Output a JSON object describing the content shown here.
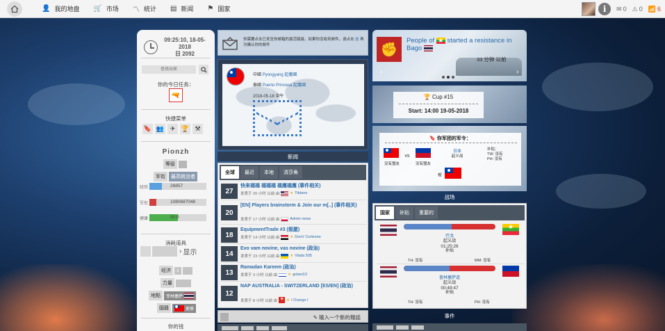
{
  "nav": {
    "items": [
      {
        "icon": "user-icon",
        "label": "我的地盘"
      },
      {
        "icon": "cart-icon",
        "label": "市场"
      },
      {
        "icon": "chart-icon",
        "label": "统计"
      },
      {
        "icon": "news-icon",
        "label": "新闻"
      },
      {
        "icon": "flag-icon",
        "label": "国家"
      }
    ],
    "messages": "0",
    "alerts": "0",
    "notifications": "6"
  },
  "left": {
    "clock_line1": "09:25:10, 18-05-",
    "clock_line2": "2018",
    "clock_line3": "日 2092",
    "search_placeholder": "查找玩家",
    "missions_label": "你的今日任务：",
    "quick_menu_label": "快捷菜单",
    "player_name": "Pionzh",
    "level_label": "等级",
    "rank_label": "军衔",
    "rank_value": "最高统治者",
    "stats": [
      {
        "label": "经验",
        "value": "26857",
        "fill_pct": 22,
        "color": "#5a9fe0"
      },
      {
        "label": "军衔",
        "value": "1080687048",
        "fill_pct": 12,
        "color": "#d04040"
      },
      {
        "label": "健康",
        "value": "50.0",
        "fill_pct": 50,
        "color": "#4cae4c"
      }
    ],
    "consumables_label": "消耗道具",
    "show_label": "显示",
    "economy_label": "经济",
    "economy_value": "1",
    "strength_label": "力量",
    "location_label": "地點",
    "location_value": "菲林塞萨",
    "citizenship_label": "國籍",
    "citizenship_value": "更换",
    "money_label": "你的钱"
  },
  "notice": {
    "text_part1": "你需要点击已发至你邮箱的激活链接，如果你没收到邮件，请点击",
    "link": "这",
    "text_part2": "再次确认你的邮件"
  },
  "news": {
    "line1_prefix": "中國",
    "line1_city": "Pyongyang",
    "line1_link": "起義國",
    "line2_prefix": "泰國",
    "line2_city": "Puerto Princesa",
    "line2_link": "起義國",
    "date": "2018-05-18 中午",
    "caption": "新闻"
  },
  "feed": {
    "tabs": [
      "全球",
      "最近",
      "本地",
      "清莎角"
    ],
    "items": [
      {
        "count": "27",
        "title": "快来福福 福福福 福鹰福鹰 (事件相关)",
        "meta": "发表于 20 小时 以前 由",
        "author": "Tibbers",
        "flag": "f-us"
      },
      {
        "count": "20",
        "title": "[EN] Players brainstorm & Join our m[..] (事件相关)",
        "meta": "发表于 17 小时 以前 由",
        "author": "Admin news",
        "flag": "f-pl"
      },
      {
        "count": "18",
        "title": "EquipmentTrade #3 (假屋)",
        "meta": "发表于 14 小时 以前 由",
        "author": "DonV Corleone",
        "flag": "f-eg"
      },
      {
        "count": "14",
        "title": "Evo vam novine, vas novine (政治)",
        "meta": "发表于 23 小时 以前 由",
        "author": "Vlada 505",
        "flag": "f-ua"
      },
      {
        "count": "13",
        "title": "Ramadan Kareem (政治)",
        "meta": "发表于 3 小时 以前 由",
        "author": "golani13",
        "flag": "f-il"
      },
      {
        "count": "12",
        "title": "NAP AUSTRALIA - SWITZERLAND [ES/EN] (政治)",
        "meta": "发表于 8 小时 以前 由",
        "author": "I Orange I",
        "flag": "f-ch"
      }
    ],
    "write_label": "输入一个新的報話"
  },
  "resistance": {
    "title_pre": "People of",
    "title_post": "started a resistance in Bago",
    "time": "33 分钟 以前"
  },
  "cup": {
    "title": "Cup #15",
    "start": "Start: 14:00 19-05-2018"
  },
  "army": {
    "heading": "你军团的军令：",
    "left_caption": "没有盟友",
    "vs": "vs",
    "mid_caption": "没有盟友",
    "link_name": "日本",
    "link_sub": "起义战",
    "right_line1": "补贴：",
    "right_line2": "TW: 没有",
    "right_line3": "PH: 没有",
    "help_label": "帮"
  },
  "battles_section": {
    "label": "战场",
    "tabs": [
      "国家",
      "补贴",
      "重要的"
    ],
    "items": [
      {
        "name": "巴戈",
        "type": "起义战",
        "timer": "01:25:26",
        "sub": "补贴",
        "left_flag": "f-th",
        "right_flag": "f-mm",
        "left_foot": "TH: 没有",
        "right_foot": "MM: 没有",
        "left_pct": 52
      },
      {
        "name": "普林塞萨道",
        "type": "起义战",
        "timer": "00:49:47",
        "sub": "补贴",
        "left_flag": "f-th",
        "right_flag": "f-ph",
        "left_foot": "TH: 没有",
        "right_foot": "PH: 没有",
        "left_pct": 50
      }
    ],
    "event_label": "事件"
  }
}
